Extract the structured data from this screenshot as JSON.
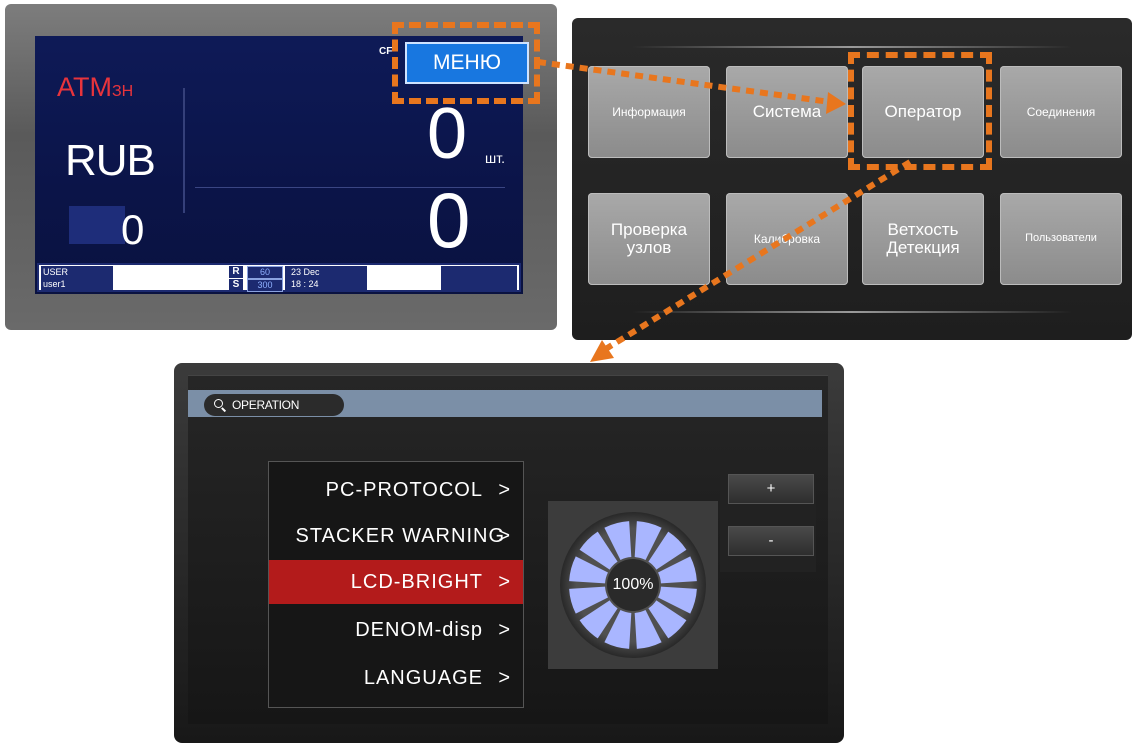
{
  "main_screen": {
    "mode": "ATM",
    "mode_sub": "ЗН",
    "currency": "RUB",
    "cf_label": "CF",
    "menu_button": "МЕНЮ",
    "count": "0",
    "count_unit": "шт.",
    "amount": "0",
    "batch": "0",
    "status": {
      "user_label": "USER",
      "user_name": "user1",
      "r_badge": "R",
      "r_value": "60",
      "s_badge": "S",
      "s_value": "300",
      "date": "23 Dec",
      "time": "18 : 24"
    }
  },
  "menu_grid": {
    "buttons": [
      "Информация",
      "Система",
      "Оператор",
      "Соединения",
      "Проверка узлов",
      "Калибровка",
      "Ветхость Детекция",
      "Пользователи"
    ]
  },
  "operation": {
    "title": "OPERATION",
    "items": [
      {
        "label": "PC-PROTOCOL",
        "chevron": ">"
      },
      {
        "label": "STACKER WARNING",
        "chevron": ">"
      },
      {
        "label": "LCD-BRIGHT",
        "chevron": ">"
      },
      {
        "label": "DENOM-disp",
        "chevron": ">"
      },
      {
        "label": "LANGUAGE",
        "chevron": ">"
      }
    ],
    "selected_index": 2,
    "brightness": "100%",
    "plus": "+",
    "minus": "-"
  },
  "colors": {
    "highlight": "#e8761e",
    "lcd_background": "#0e1a57",
    "menu_button_blue": "#1877e0",
    "atm_red": "#e8343c",
    "selected_item": "#b31b1b",
    "dial_segments": "#a9b6ff"
  }
}
